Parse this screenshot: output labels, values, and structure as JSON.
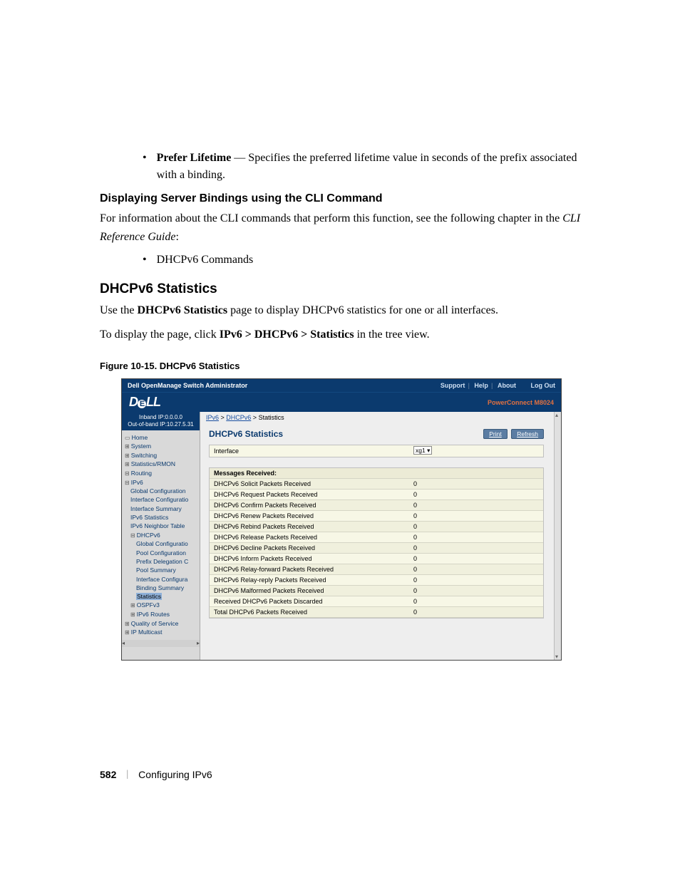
{
  "bullet1": {
    "term": "Prefer Lifetime",
    "desc": " — Specifies the preferred lifetime value in seconds of the prefix associated with a binding."
  },
  "h2_cli": "Displaying Server Bindings using the CLI Command",
  "cli_body_1": "For information about the CLI commands that perform this function, see the following chapter in the ",
  "cli_body_2": "CLI Reference Guide",
  "cli_body_3": ":",
  "bullet2": "DHCPv6 Commands",
  "h1_stats": "DHCPv6 Statistics",
  "stats_body_1_pre": "Use the ",
  "stats_body_1_bold": "DHCPv6 Statistics",
  "stats_body_1_post": " page to display DHCPv6 statistics for one or all interfaces.",
  "stats_body_2_pre": "To display the page, click ",
  "stats_body_2_bold": "IPv6 > DHCPv6 > Statistics",
  "stats_body_2_post": " in the tree view.",
  "figure_caption": "Figure 10-15.    DHCPv6 Statistics",
  "shot": {
    "topbar_title": "Dell OpenManage Switch Administrator",
    "topbar_links": [
      "Support",
      "Help",
      "About",
      "Log Out"
    ],
    "model": "PowerConnect M8024",
    "ips": {
      "inband": "Inband IP:0.0.0.0",
      "oob": "Out-of-band IP:10.27.5.31"
    },
    "breadcrumb": {
      "a": "IPv6",
      "b": "DHCPv6",
      "c": "Statistics"
    },
    "nav": [
      {
        "l": 0,
        "t": "Home",
        "ic": "▭"
      },
      {
        "l": 0,
        "t": "System",
        "ic": "⊞"
      },
      {
        "l": 0,
        "t": "Switching",
        "ic": "⊞"
      },
      {
        "l": 0,
        "t": "Statistics/RMON",
        "ic": "⊞"
      },
      {
        "l": 0,
        "t": "Routing",
        "ic": "⊟"
      },
      {
        "l": 0,
        "t": "IPv6",
        "ic": "⊟"
      },
      {
        "l": 1,
        "t": "Global Configuration"
      },
      {
        "l": 1,
        "t": "Interface Configuratio"
      },
      {
        "l": 1,
        "t": "Interface Summary"
      },
      {
        "l": 1,
        "t": "IPv6 Statistics"
      },
      {
        "l": 1,
        "t": "IPv6 Neighbor Table"
      },
      {
        "l": 1,
        "t": "DHCPv6",
        "ic": "⊟"
      },
      {
        "l": 2,
        "t": "Global Configuratio"
      },
      {
        "l": 2,
        "t": "Pool Configuration"
      },
      {
        "l": 2,
        "t": "Prefix Delegation C"
      },
      {
        "l": 2,
        "t": "Pool Summary"
      },
      {
        "l": 2,
        "t": "Interface Configura"
      },
      {
        "l": 2,
        "t": "Binding Summary"
      },
      {
        "l": 2,
        "t": "Statistics",
        "sel": true
      },
      {
        "l": 1,
        "t": "OSPFv3",
        "ic": "⊞"
      },
      {
        "l": 1,
        "t": "IPv6 Routes",
        "ic": "⊞"
      },
      {
        "l": 0,
        "t": "Quality of Service",
        "ic": "⊞"
      },
      {
        "l": 0,
        "t": "IP Multicast",
        "ic": "⊞"
      }
    ],
    "panel_title": "DHCPv6 Statistics",
    "buttons": {
      "print": "Print",
      "refresh": "Refresh"
    },
    "iface_label": "Interface",
    "iface_value": "xg1",
    "msg_head": "Messages Received:",
    "rows": [
      {
        "k": "DHCPv6 Solicit Packets Received",
        "v": "0"
      },
      {
        "k": "DHCPv6 Request Packets Received",
        "v": "0"
      },
      {
        "k": "DHCPv6 Confirm Packets Received",
        "v": "0"
      },
      {
        "k": "DHCPv6 Renew Packets Received",
        "v": "0"
      },
      {
        "k": "DHCPv6 Rebind Packets Received",
        "v": "0"
      },
      {
        "k": "DHCPv6 Release Packets Received",
        "v": "0"
      },
      {
        "k": "DHCPv6 Decline Packets Received",
        "v": "0"
      },
      {
        "k": "DHCPv6 Inform Packets Received",
        "v": "0"
      },
      {
        "k": "DHCPv6 Relay-forward Packets Received",
        "v": "0"
      },
      {
        "k": "DHCPv6 Relay-reply Packets Received",
        "v": "0"
      },
      {
        "k": "DHCPv6 Malformed Packets Received",
        "v": "0"
      },
      {
        "k": "Received DHCPv6 Packets Discarded",
        "v": "0"
      },
      {
        "k": "Total DHCPv6 Packets Received",
        "v": "0"
      }
    ]
  },
  "footer": {
    "page": "582",
    "title": "Configuring IPv6"
  }
}
